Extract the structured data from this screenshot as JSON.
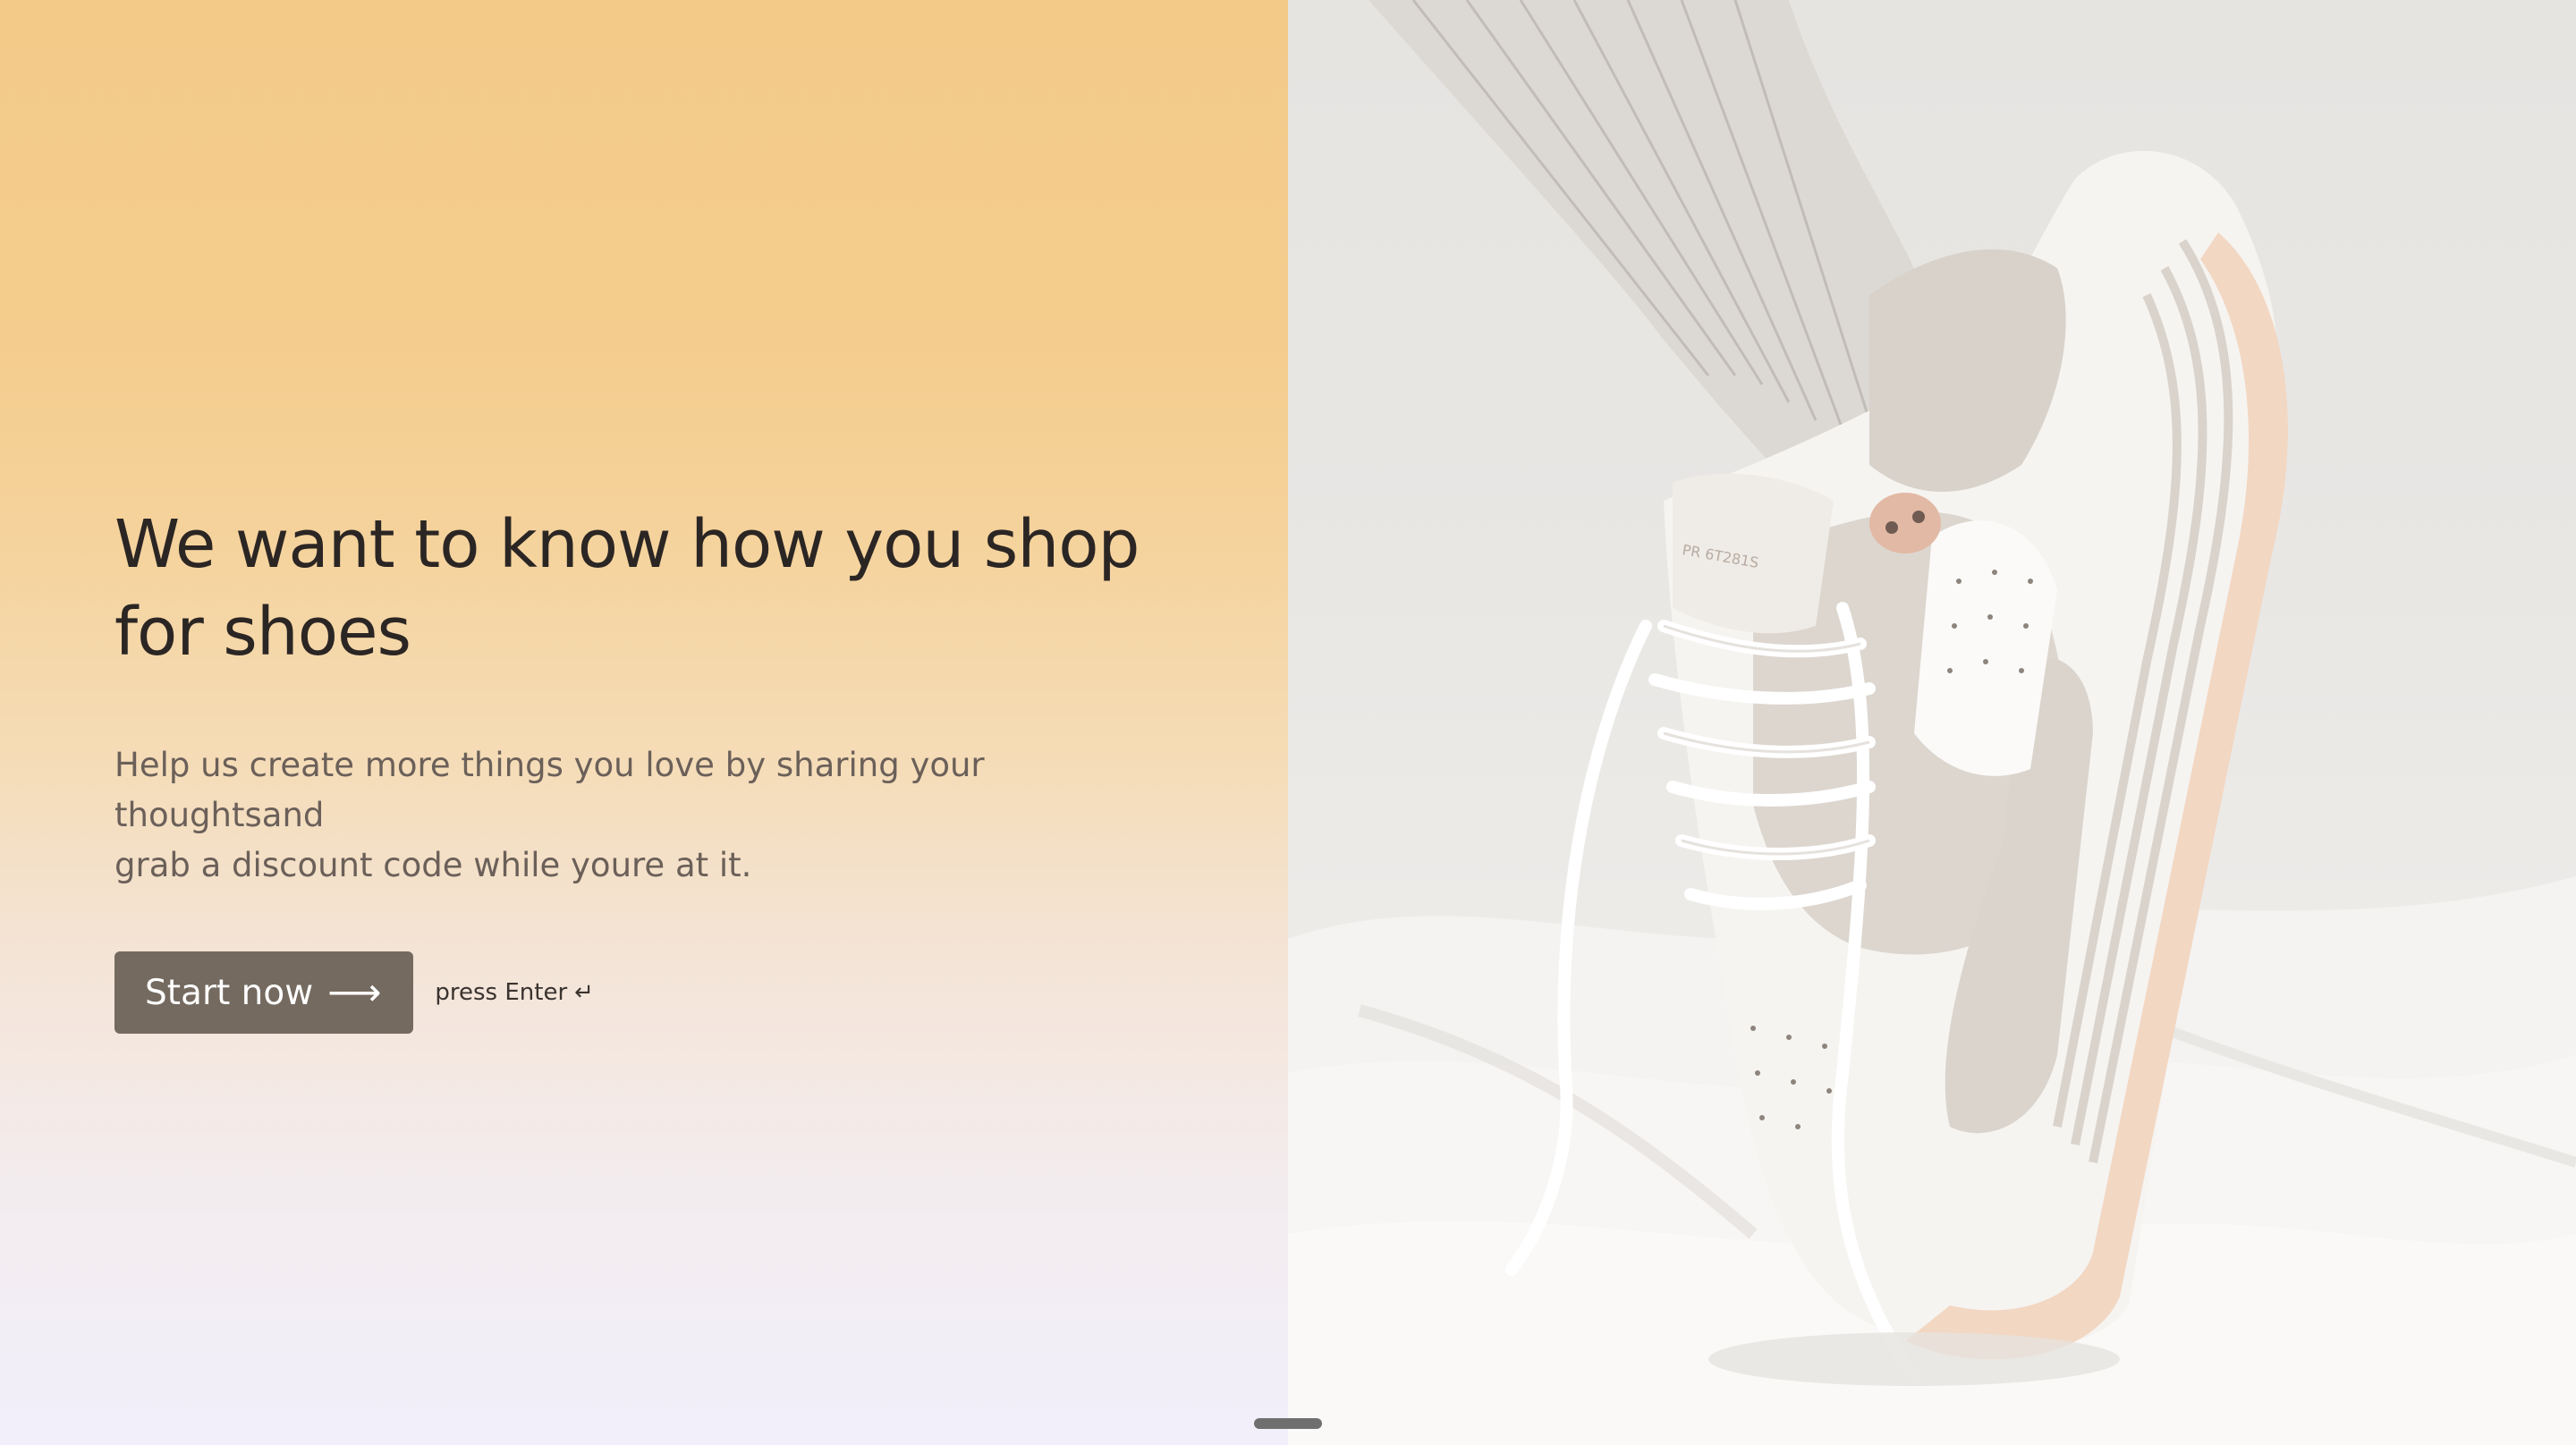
{
  "hero": {
    "headline_line1": "We want to know how you shop",
    "headline_line2": "for shoes",
    "subtext_line1": "Help us create more things you love by sharing your thoughtsand",
    "subtext_line2": "grab a discount code while youre at it."
  },
  "cta": {
    "button_label": "Start now",
    "button_icon": "arrow-right-icon",
    "hint_label": "press Enter",
    "hint_icon": "enter-key-icon"
  },
  "image": {
    "subject": "white sneaker with laces on foot in ribbed sock"
  },
  "colors": {
    "headline": "#2b2624",
    "subtext": "#6b6059",
    "button_bg": "#746a60",
    "button_text": "#ffffff",
    "gradient_top": "#f3ca88",
    "gradient_bottom": "#f2effb"
  }
}
